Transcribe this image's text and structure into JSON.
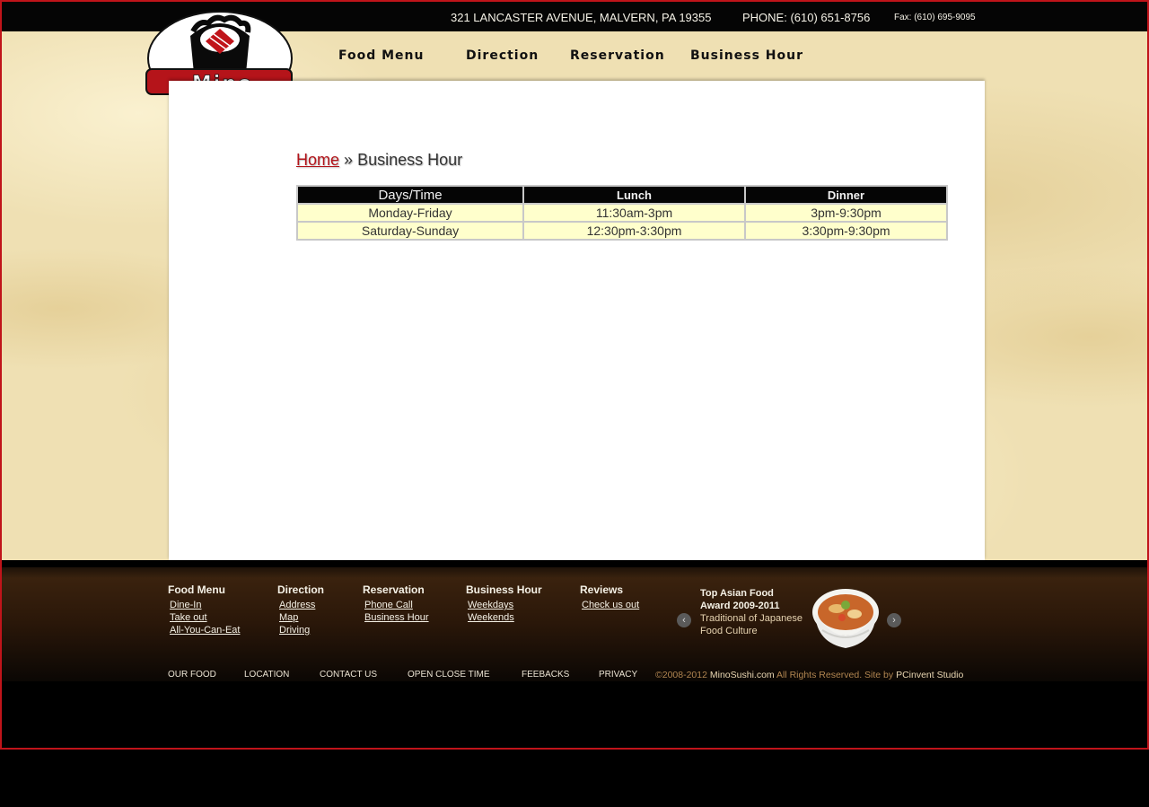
{
  "header": {
    "address": "321 LANCASTER AVENUE, MALVERN, PA 19355",
    "phone": "PHONE: (610) 651-8756",
    "fax": "Fax: (610) 695-9095",
    "logo_text": "Mino"
  },
  "nav": {
    "items": [
      "Food Menu",
      "Direction",
      "Reservation",
      "Business Hour"
    ]
  },
  "breadcrumb": {
    "home": "Home",
    "separator": "»",
    "current": "Business Hour"
  },
  "hours_table": {
    "headers": [
      "Days/Time",
      "Lunch",
      "Dinner"
    ],
    "rows": [
      [
        "Monday-Friday",
        "11:30am-3pm",
        "3pm-9:30pm"
      ],
      [
        "Saturday-Sunday",
        "12:30pm-3:30pm",
        "3:30pm-9:30pm"
      ]
    ]
  },
  "footer": {
    "columns": [
      {
        "heading": "Food Menu",
        "links": [
          "Dine-In",
          "Take out",
          "All-You-Can-Eat"
        ]
      },
      {
        "heading": "Direction",
        "links": [
          "Address",
          "Map",
          "Driving"
        ]
      },
      {
        "heading": "Reservation",
        "links": [
          "Phone Call",
          "Business Hour"
        ]
      },
      {
        "heading": "Business Hour",
        "links": [
          "Weekdays",
          "Weekends"
        ]
      },
      {
        "heading": "Reviews",
        "links": [
          "Check us out"
        ]
      }
    ],
    "award": {
      "title_line1": "Top Asian Food",
      "title_line2": "Award 2009-2011",
      "desc_line1": "Traditional of Japanese",
      "desc_line2": "Food Culture"
    },
    "bottom_links": [
      "OUR FOOD",
      "LOCATION",
      "CONTACT US",
      "OPEN CLOSE TIME",
      "FEEBACKS",
      "PRIVACY"
    ],
    "copyright": {
      "prefix": "©2008-2012",
      "site": "MinoSushi.com",
      "middle": "All Rights Reserved. Site by",
      "studio": "PCinvent Studio"
    }
  },
  "colors": {
    "accent_red": "#b3141a",
    "frame_red": "#c0141a",
    "table_cell_bg": "#ffffcc",
    "header_black": "#050505"
  }
}
